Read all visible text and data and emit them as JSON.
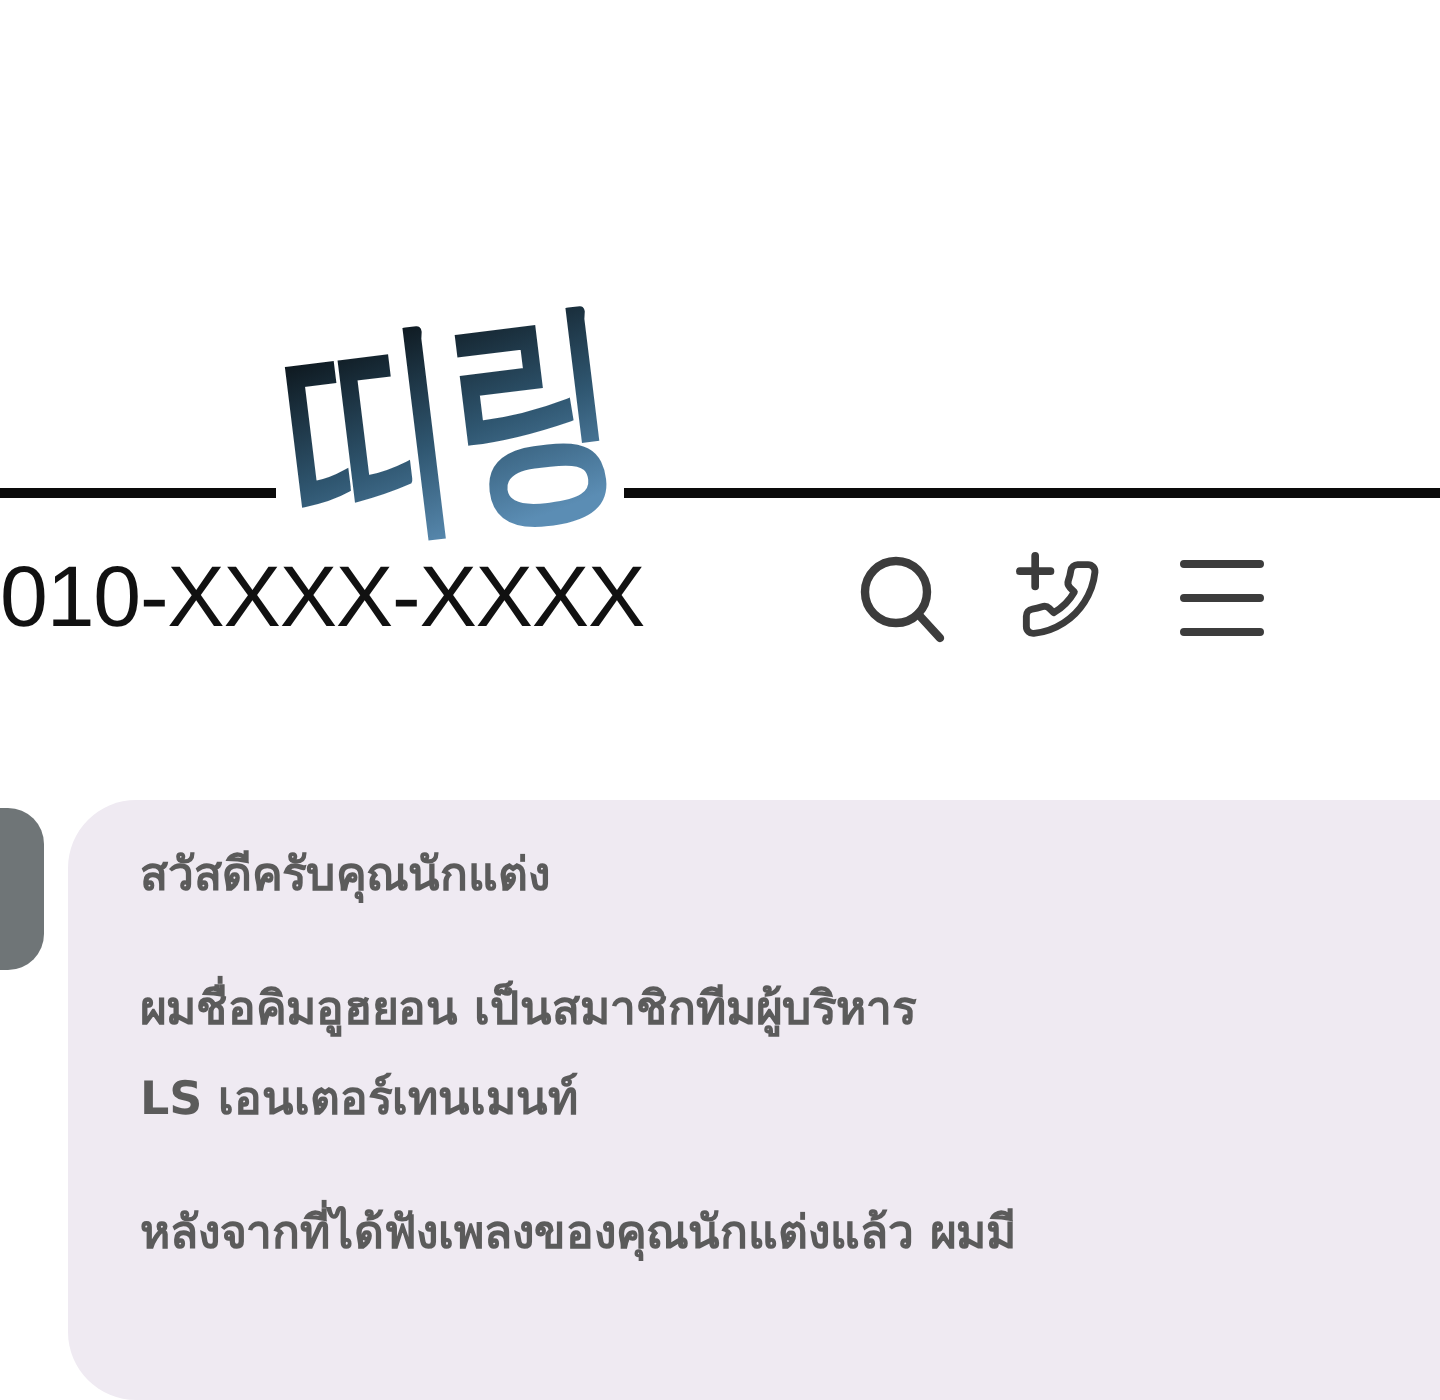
{
  "sound_effect": "띠링",
  "header": {
    "phone_number": "010-XXXX-XXXX"
  },
  "message": {
    "paragraphs": [
      {
        "lines": [
          "สวัสดีครับคุณนักแต่ง"
        ]
      },
      {
        "lines": [
          "ผมชื่อคิมอูฮยอน เป็นสมาชิกทีมผู้บริหาร",
          "LS เอนเตอร์เทนเมนท์"
        ]
      },
      {
        "lines": [
          "หลังจากที่ได้ฟังเพลงของคุณนักแต่งแล้ว ผมมี"
        ]
      }
    ]
  }
}
